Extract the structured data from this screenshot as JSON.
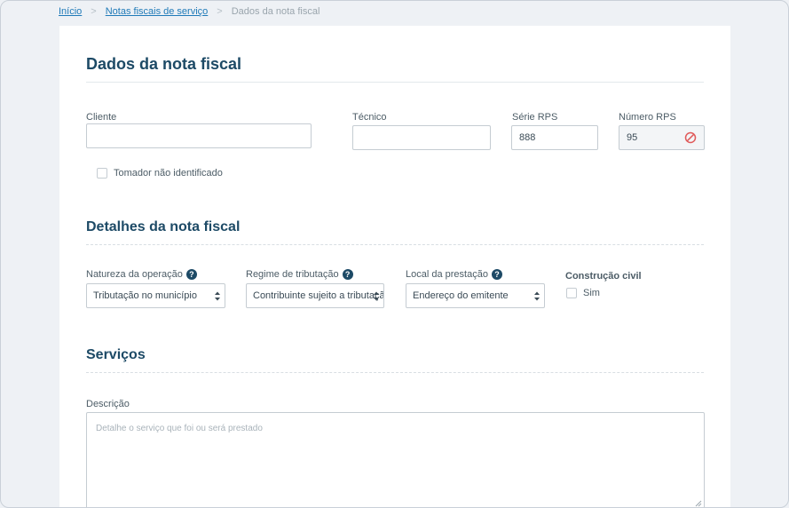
{
  "breadcrumb": {
    "home": "Início",
    "invoices": "Notas fiscais de serviço",
    "current": "Dados da nota fiscal",
    "separator": ">"
  },
  "sections": {
    "invoice_data": "Dados da nota fiscal",
    "invoice_details": "Detalhes da nota fiscal",
    "services": "Serviços"
  },
  "fields": {
    "client": {
      "label": "Cliente",
      "value": ""
    },
    "technician": {
      "label": "Técnico",
      "value": ""
    },
    "rps_series": {
      "label": "Série RPS",
      "value": "888"
    },
    "rps_number": {
      "label": "Número RPS",
      "value": "95"
    },
    "unidentified_taker": {
      "label": "Tomador não identificado",
      "checked": false
    },
    "operation_nature": {
      "label": "Natureza da operação",
      "value": "Tributação no município"
    },
    "tax_regime": {
      "label": "Regime de tributação",
      "value": "Contribuinte sujeito a tributação"
    },
    "service_location": {
      "label": "Local da prestação",
      "value": "Endereço do emitente"
    },
    "construction": {
      "label": "Construção civil",
      "option": "Sim",
      "checked": false
    },
    "description": {
      "label": "Descrição",
      "placeholder": "Detalhe o serviço que foi ou será prestado"
    }
  },
  "help_glyph": "?",
  "colors": {
    "accent": "#1d4a66",
    "link": "#1f7ab8",
    "blocked": "#e05a5a"
  }
}
